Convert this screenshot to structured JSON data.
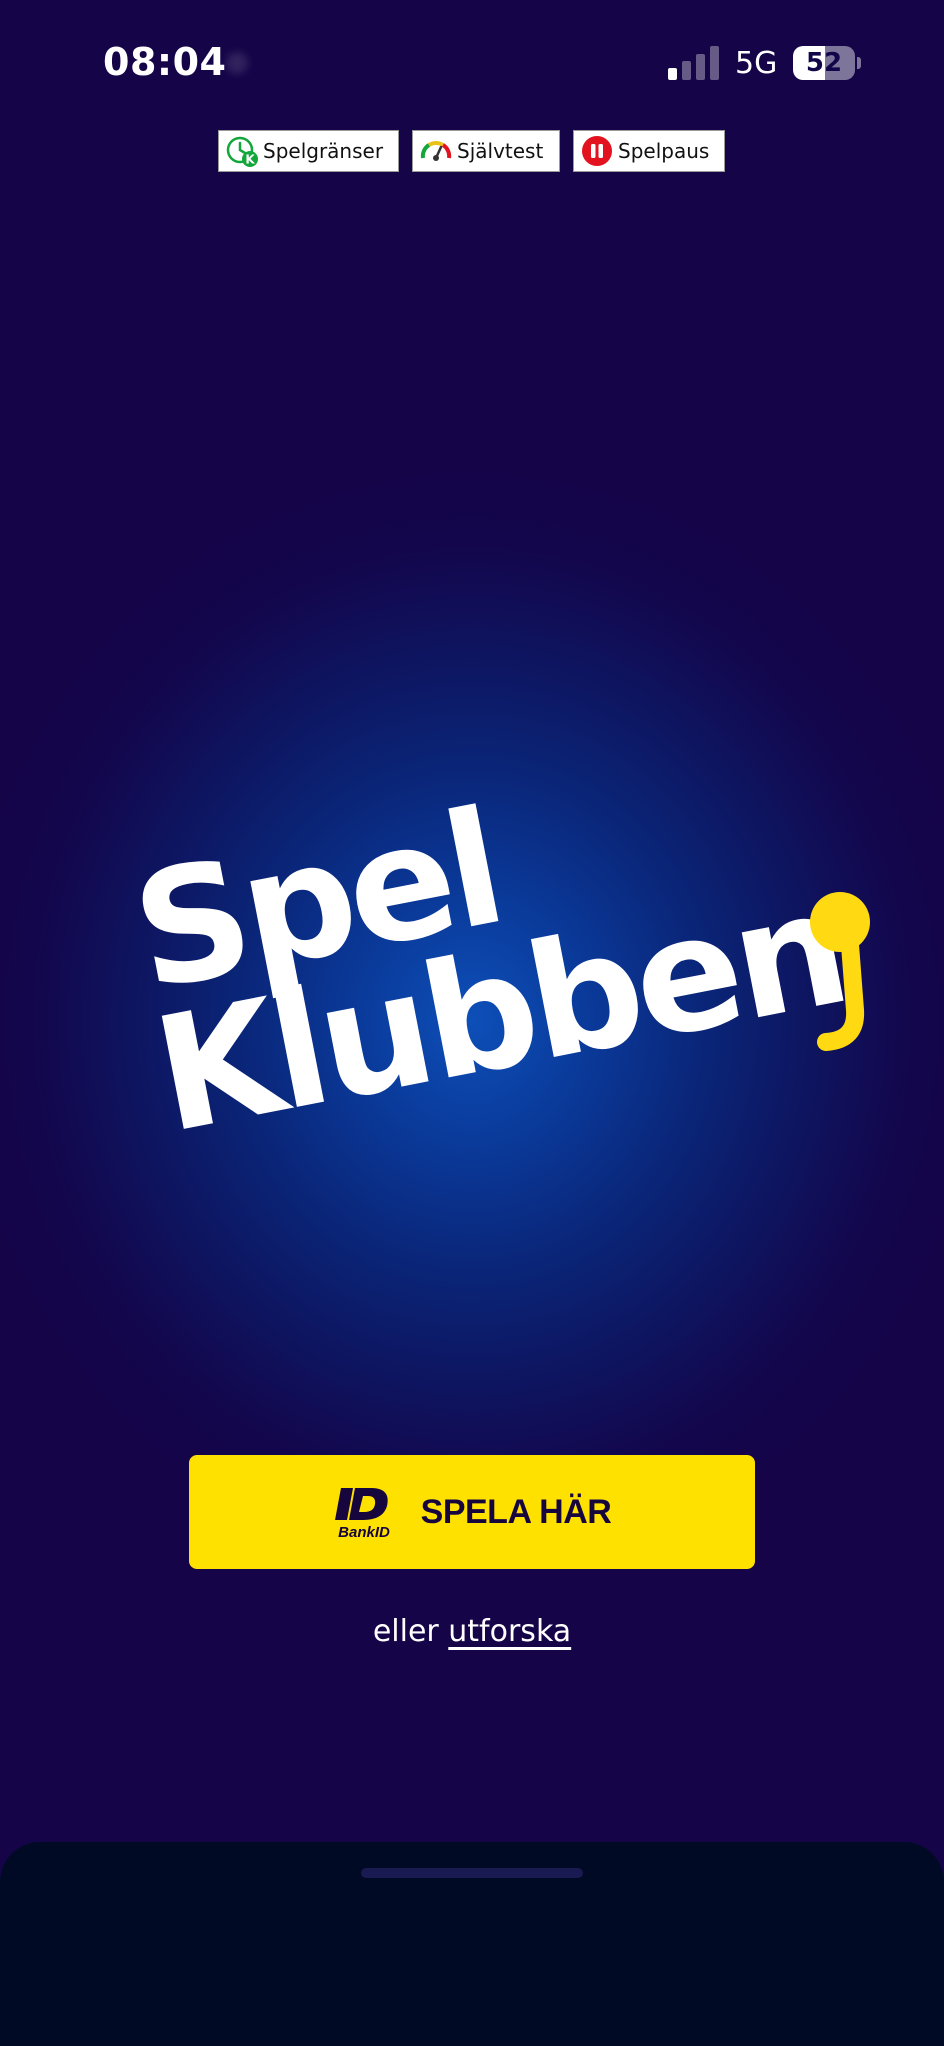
{
  "status_bar": {
    "time": "08:04",
    "network": "5G",
    "battery_level": "52",
    "signal_bars_active": 1,
    "signal_bars_total": 4
  },
  "badges": [
    {
      "label": "Spelgränser",
      "icon": "spelgranser-icon",
      "color": "#12a63b"
    },
    {
      "label": "Självtest",
      "icon": "sjalvtest-gauge-icon",
      "color": "#e8a317"
    },
    {
      "label": "Spelpaus",
      "icon": "spelpaus-icon",
      "color": "#e2121e"
    }
  ],
  "logo": {
    "line1": "Spel",
    "line2": "Klubben",
    "accent_color": "#ffd911"
  },
  "cta": {
    "bankid_text": "BankID",
    "label": "SPELA HÄR",
    "background": "#ffe100"
  },
  "explore": {
    "prefix": "eller",
    "link": "utforska"
  },
  "colors": {
    "background": "#13054a",
    "glow": "#0d4fb8",
    "sheet": "#010a24"
  }
}
